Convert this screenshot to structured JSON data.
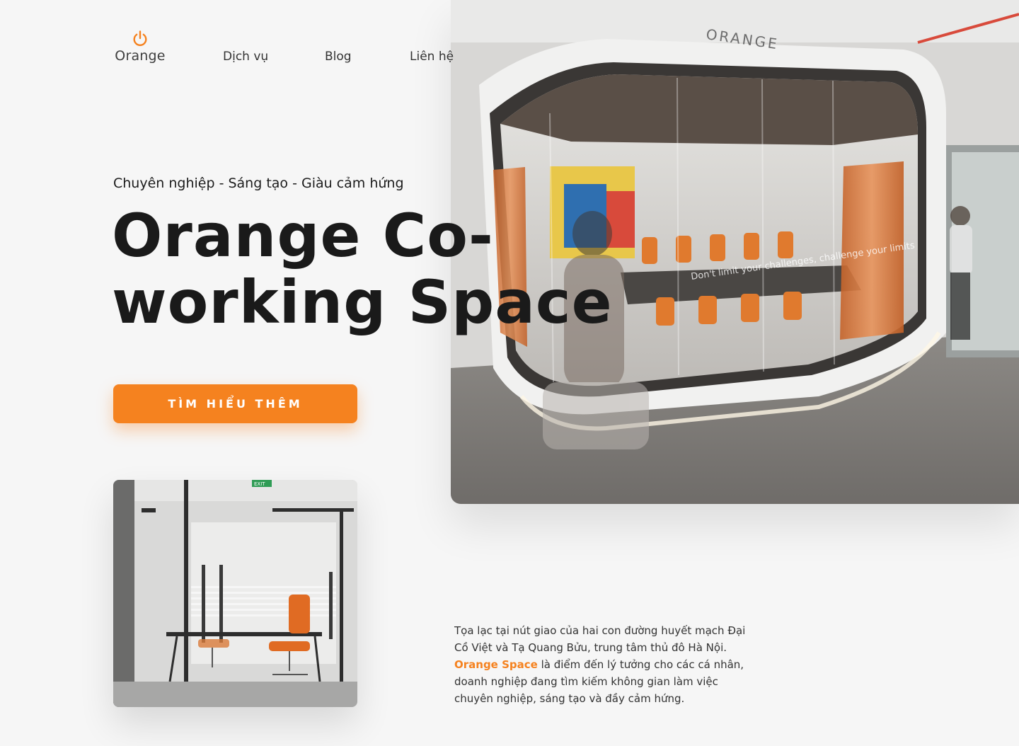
{
  "brand": {
    "name": "Orange",
    "accent_color": "#f5821f",
    "icon": "power-icon"
  },
  "nav": {
    "items": [
      {
        "label": "Dịch vụ"
      },
      {
        "label": "Blog"
      },
      {
        "label": "Liên hệ"
      }
    ]
  },
  "hero": {
    "tagline": "Chuyên nghiệp - Sáng tạo - Giàu cảm hứng",
    "title_line1": "Orange Co-",
    "title_line2": "working Space",
    "cta_label": "TÌM HIỂU THÊM",
    "photo": {
      "sign_text": "ORANGE",
      "glass_text": "Don't limit your challenges, challenge your limits"
    }
  },
  "small_photo": {
    "exit_sign": "EXIT"
  },
  "description": {
    "text_before": "Tọa lạc tại nút giao của hai con đường huyết mạch Đại Cồ Việt và Tạ Quang Bửu, trung tâm thủ đô Hà Nội.",
    "brand_highlight": "Orange Space",
    "text_after": "là điểm đến lý tưởng cho các cá nhân, doanh nghiệp đang tìm kiếm không gian làm việc chuyên nghiệp, sáng tạo và đầy cảm hứng."
  }
}
